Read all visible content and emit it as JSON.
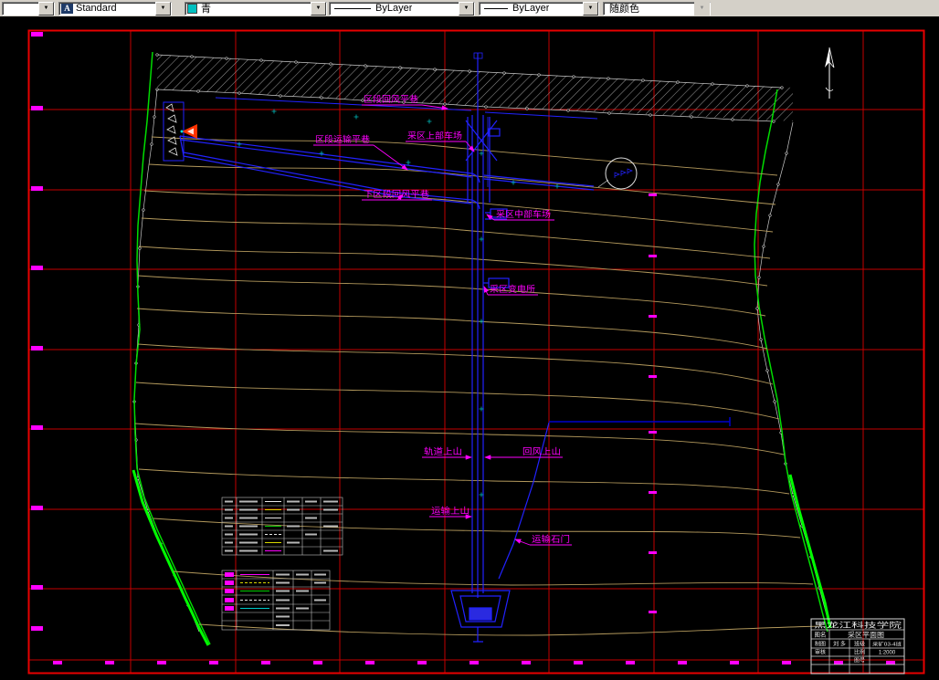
{
  "toolbar": {
    "icons": {
      "dropdown_arrow": "▼",
      "text_style_glyph": "A"
    },
    "left_combo": {
      "value": ""
    },
    "style_combo": {
      "value": "Standard"
    },
    "color_combo": {
      "value": "青",
      "swatch_color": "#00c0c0"
    },
    "linetype_combo": {
      "value": "ByLayer"
    },
    "lineweight_combo": {
      "value": "ByLayer"
    },
    "plotstyle_combo": {
      "value": "随颜色"
    }
  },
  "drawing": {
    "colors": {
      "grid": "#c40000",
      "frame": "#e80000",
      "boundary": "#00dd00",
      "roadway": "#2222ff",
      "contour": "#b3995c",
      "annotation": "#ff00ff"
    },
    "labels": [
      {
        "text": "区段回风平巷"
      },
      {
        "text": "区段运输平巷"
      },
      {
        "text": "采区上部车场"
      },
      {
        "text": "下区段回风平巷"
      },
      {
        "text": "采区中部车场"
      },
      {
        "text": "采区变电所"
      },
      {
        "text": "轨道上山"
      },
      {
        "text": "回风上山"
      },
      {
        "text": "运输上山"
      },
      {
        "text": "运输石门"
      }
    ],
    "title_block": {
      "school": "黑龙江科技学院",
      "drawing_name_label": "图名",
      "drawing_name": "采区平面图",
      "drafter_label": "制图",
      "drafter_name": "刘 多",
      "class_label": "班级",
      "class_name": "采矿03-4班",
      "checker_label": "审核",
      "scale_label": "比例",
      "scale_value": "1:2000",
      "sheet_label": "图号"
    }
  }
}
